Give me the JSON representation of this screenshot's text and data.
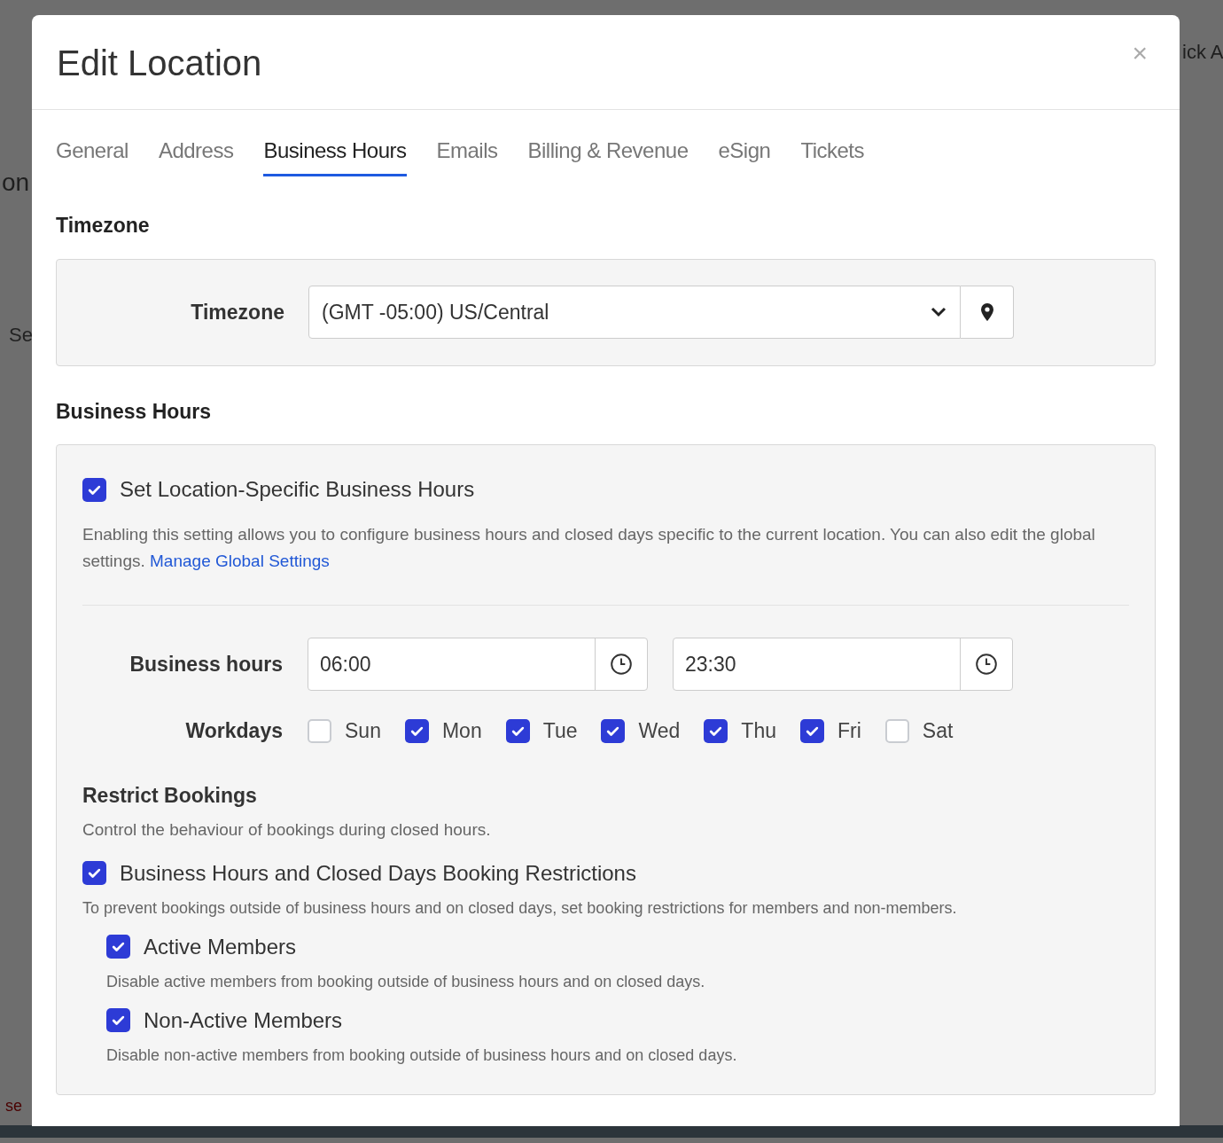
{
  "background": {
    "fragments": [
      {
        "text": "on",
        "kind": "dark"
      },
      {
        "text": "Se",
        "kind": "muted"
      },
      {
        "text": "ick A",
        "kind": "dark"
      },
      {
        "text": "se",
        "kind": "error"
      }
    ]
  },
  "dialog": {
    "title": "Edit Location",
    "close": "×"
  },
  "tabs": [
    {
      "label": "General",
      "selected": false
    },
    {
      "label": "Address",
      "selected": false
    },
    {
      "label": "Business Hours",
      "selected": true
    },
    {
      "label": "Emails",
      "selected": false
    },
    {
      "label": "Billing & Revenue",
      "selected": false
    },
    {
      "label": "eSign",
      "selected": false
    },
    {
      "label": "Tickets",
      "selected": false
    }
  ],
  "timezone_section": {
    "heading": "Timezone",
    "label": "Timezone",
    "value": "(GMT -05:00) US/Central"
  },
  "business_hours_section": {
    "heading": "Business Hours",
    "specific": {
      "label": "Set Location-Specific Business Hours",
      "checked": true
    },
    "description": "Enabling this setting allows you to configure business hours and closed days specific to the current location. You can also edit the global settings.",
    "link": "Manage Global Settings",
    "hours": {
      "label": "Business hours",
      "start": "06:00",
      "end": "23:30"
    },
    "workdays": {
      "label": "Workdays",
      "days": [
        {
          "label": "Sun",
          "checked": false
        },
        {
          "label": "Mon",
          "checked": true
        },
        {
          "label": "Tue",
          "checked": true
        },
        {
          "label": "Wed",
          "checked": true
        },
        {
          "label": "Thu",
          "checked": true
        },
        {
          "label": "Fri",
          "checked": true
        },
        {
          "label": "Sat",
          "checked": false
        }
      ]
    },
    "restrict": {
      "heading": "Restrict Bookings",
      "description": "Control the behaviour of bookings during closed hours.",
      "options": [
        {
          "label": "Business Hours and Closed Days Booking Restrictions",
          "checked": true,
          "description": "To prevent bookings outside of business hours and on closed days, set booking restrictions for members and non-members.",
          "children": [
            {
              "label": "Active Members",
              "checked": true,
              "description": "Disable active members from booking outside of business hours and on closed days."
            },
            {
              "label": "Non-Active Members",
              "checked": true,
              "description": "Disable non-active members from booking outside of business hours and on closed days."
            }
          ]
        }
      ]
    }
  }
}
